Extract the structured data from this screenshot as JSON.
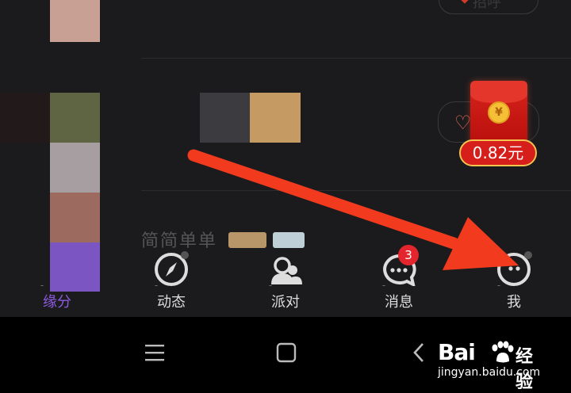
{
  "feed": {
    "follow_label": "招呼",
    "reward_amount": "0.82元",
    "coin_symbol": "¥",
    "nickname": "简简单单"
  },
  "tabs": [
    {
      "label": "缘分",
      "icon": "heart-icon",
      "active": true
    },
    {
      "label": "动态",
      "icon": "compass-icon",
      "active": false
    },
    {
      "label": "派对",
      "icon": "group-icon",
      "active": false
    },
    {
      "label": "消息",
      "icon": "chat-icon",
      "active": false,
      "badge": "3"
    },
    {
      "label": "我",
      "icon": "profile-icon",
      "active": false
    }
  ],
  "watermark": {
    "brand": "Bai",
    "cn": "经验",
    "url": "jingyan.baidu.com"
  },
  "colors": {
    "accent": "#8d5be0",
    "badge": "#e3262d",
    "annotation_arrow": "#f23a1e",
    "red_packet": "#d8231c"
  }
}
